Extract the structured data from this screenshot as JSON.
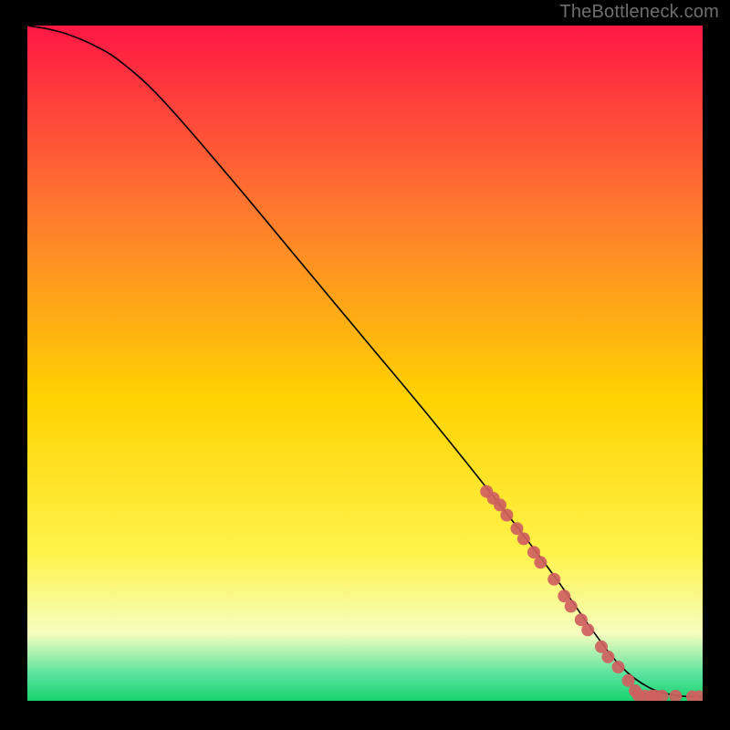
{
  "watermark": "TheBottleneck.com",
  "colors": {
    "frame_bg": "#000000",
    "watermark_text": "#6e6e6e",
    "curve_stroke": "#000000",
    "marker_fill": "#cf6060",
    "gradient_top": "#ff1744",
    "gradient_upper_mid": "#ff7b2e",
    "gradient_mid": "#ffd200",
    "gradient_lower_mid": "#fff34a",
    "gradient_pale": "#f6ffbf",
    "gradient_mint": "#5be29e",
    "gradient_green": "#17d36e"
  },
  "chart_data": {
    "type": "line",
    "title": "",
    "xlabel": "",
    "ylabel": "",
    "xlim": [
      0,
      100
    ],
    "ylim": [
      0,
      100
    ],
    "grid": false,
    "legend": false,
    "series": [
      {
        "name": "curve",
        "x": [
          0,
          3,
          6,
          10,
          14,
          20,
          30,
          40,
          50,
          60,
          70,
          78,
          84,
          88,
          92,
          96,
          100
        ],
        "y": [
          100,
          99.5,
          98.7,
          97,
          94.5,
          89,
          77.5,
          65.5,
          53.5,
          41.5,
          29,
          18.5,
          10,
          5,
          2,
          0.8,
          0.6
        ]
      }
    ],
    "markers": [
      {
        "x": 68,
        "y": 31
      },
      {
        "x": 69,
        "y": 30
      },
      {
        "x": 70,
        "y": 29
      },
      {
        "x": 71,
        "y": 27.5
      },
      {
        "x": 72.5,
        "y": 25.5
      },
      {
        "x": 73.5,
        "y": 24
      },
      {
        "x": 75,
        "y": 22
      },
      {
        "x": 76,
        "y": 20.5
      },
      {
        "x": 78,
        "y": 18
      },
      {
        "x": 79.5,
        "y": 15.5
      },
      {
        "x": 80.5,
        "y": 14
      },
      {
        "x": 82,
        "y": 12
      },
      {
        "x": 83,
        "y": 10.5
      },
      {
        "x": 85,
        "y": 8
      },
      {
        "x": 86,
        "y": 6.5
      },
      {
        "x": 87.5,
        "y": 5
      },
      {
        "x": 89,
        "y": 3
      },
      {
        "x": 90,
        "y": 1.5
      },
      {
        "x": 90.5,
        "y": 0.8
      },
      {
        "x": 91.5,
        "y": 0.7
      },
      {
        "x": 92.5,
        "y": 0.7
      },
      {
        "x": 93,
        "y": 0.7
      },
      {
        "x": 94,
        "y": 0.7
      },
      {
        "x": 96,
        "y": 0.7
      },
      {
        "x": 98.5,
        "y": 0.6
      },
      {
        "x": 99.5,
        "y": 0.6
      }
    ]
  }
}
